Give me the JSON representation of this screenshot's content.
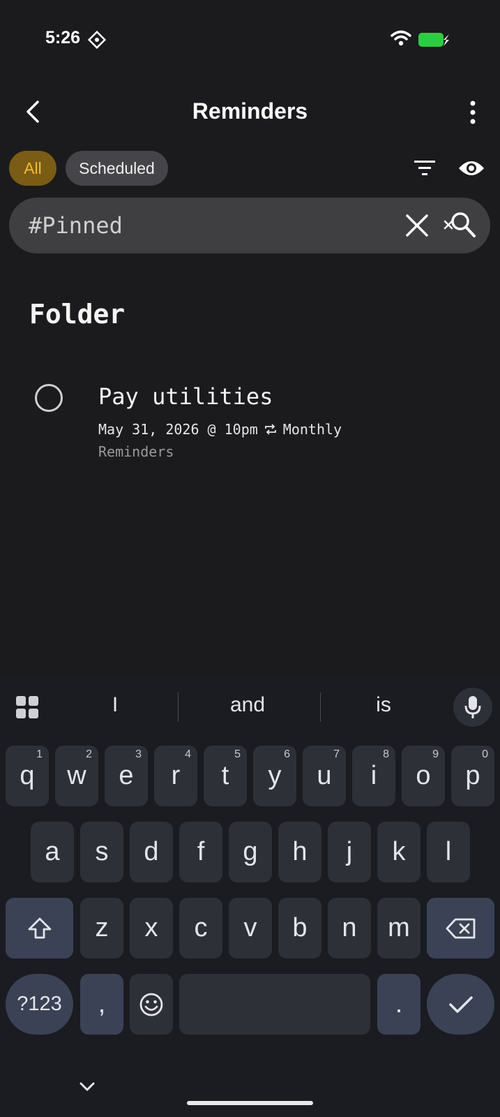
{
  "status_bar": {
    "time": "5:26"
  },
  "header": {
    "title": "Reminders"
  },
  "chips": [
    {
      "label": "All",
      "active": true
    },
    {
      "label": "Scheduled",
      "active": false
    }
  ],
  "search": {
    "value": "#Pinned"
  },
  "list": {
    "section_title": "Folder",
    "items": [
      {
        "title": "Pay utilities",
        "date": "May 31, 2026 @ 10pm",
        "repeat": "Monthly",
        "list_name": "Reminders"
      }
    ]
  },
  "keyboard": {
    "suggestions": [
      "I",
      "and",
      "is"
    ],
    "row1": [
      {
        "key": "q",
        "hint": "1"
      },
      {
        "key": "w",
        "hint": "2"
      },
      {
        "key": "e",
        "hint": "3"
      },
      {
        "key": "r",
        "hint": "4"
      },
      {
        "key": "t",
        "hint": "5"
      },
      {
        "key": "y",
        "hint": "6"
      },
      {
        "key": "u",
        "hint": "7"
      },
      {
        "key": "i",
        "hint": "8"
      },
      {
        "key": "o",
        "hint": "9"
      },
      {
        "key": "p",
        "hint": "0"
      }
    ],
    "row2": [
      "a",
      "s",
      "d",
      "f",
      "g",
      "h",
      "j",
      "k",
      "l"
    ],
    "row3": [
      "z",
      "x",
      "c",
      "v",
      "b",
      "n",
      "m"
    ],
    "symbols_label": "?123",
    "comma_label": ",",
    "period_label": "."
  },
  "colors": {
    "accent": "#f2bd2b",
    "chip_active_bg": "#7a5c14",
    "battery": "#2ecc40"
  }
}
